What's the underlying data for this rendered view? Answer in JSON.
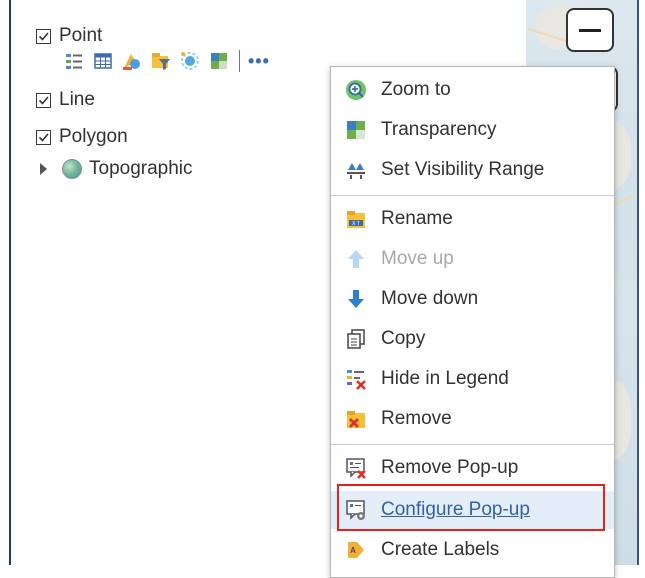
{
  "layers": [
    {
      "label": "Point",
      "checked": true
    },
    {
      "label": "Line",
      "checked": true
    },
    {
      "label": "Polygon",
      "checked": true
    }
  ],
  "basemap": {
    "label": "Topographic"
  },
  "toolbar_icons": [
    "legend-icon",
    "table-icon",
    "style-icon",
    "filter-icon",
    "cluster-icon",
    "transparency-icon"
  ],
  "more_label": "•••",
  "menu": {
    "items": [
      {
        "id": "zoom-to",
        "label": "Zoom to",
        "icon": "zoom-icon"
      },
      {
        "id": "transparency",
        "label": "Transparency",
        "icon": "transparency-icon"
      },
      {
        "id": "set-visibility-range",
        "label": "Set Visibility Range",
        "icon": "visibility-range-icon"
      },
      {
        "id": "rename",
        "label": "Rename",
        "icon": "rename-icon"
      },
      {
        "id": "move-up",
        "label": "Move up",
        "icon": "arrow-up-icon",
        "disabled": true
      },
      {
        "id": "move-down",
        "label": "Move down",
        "icon": "arrow-down-icon"
      },
      {
        "id": "copy",
        "label": "Copy",
        "icon": "copy-icon"
      },
      {
        "id": "hide-in-legend",
        "label": "Hide in Legend",
        "icon": "hide-legend-icon"
      },
      {
        "id": "remove",
        "label": "Remove",
        "icon": "remove-icon"
      },
      {
        "id": "remove-popup",
        "label": "Remove Pop-up",
        "icon": "remove-popup-icon"
      },
      {
        "id": "configure-popup",
        "label": "Configure Pop-up",
        "icon": "configure-popup-icon",
        "highlighted": true
      },
      {
        "id": "create-labels",
        "label": "Create Labels",
        "icon": "labels-icon"
      }
    ]
  },
  "colors": {
    "accent": "#3560a8",
    "highlight_box": "#e2231a",
    "disabled_text": "#a9a9a9"
  }
}
